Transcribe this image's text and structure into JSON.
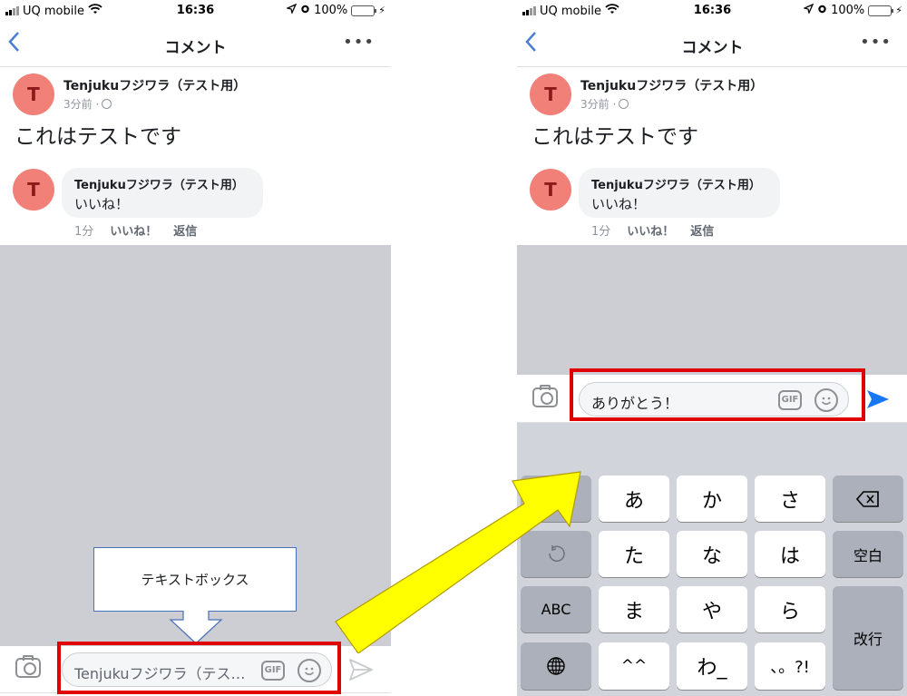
{
  "status_bar": {
    "carrier": "UQ mobile",
    "time": "16:36",
    "battery": "100%",
    "icons": [
      "signal-icon",
      "wifi-icon",
      "location-icon",
      "alarm-icon",
      "battery-icon",
      "charging-icon"
    ]
  },
  "nav": {
    "title": "コメント",
    "back_icon": "chevron-left-icon",
    "more_icon": "ellipsis-icon",
    "more_label": "•••"
  },
  "post": {
    "avatar_initial": "T",
    "author": "Tenjukuフジワラ（テスト用）",
    "time": "3分前 ·",
    "privacy_icon": "globe-icon",
    "body": "これはテストです"
  },
  "comment": {
    "avatar_initial": "T",
    "author": "Tenjukuフジワラ（テスト用）",
    "text": "いいね！",
    "time": "1分",
    "like_label": "いいね！",
    "reply_label": "返信"
  },
  "composer_left": {
    "placeholder": "Tenjukuフジワラ（テス…",
    "gif_label": "GIF",
    "emoji_label": "☺",
    "send_state": "disabled"
  },
  "composer_right": {
    "value": "ありがとう！",
    "gif_label": "GIF",
    "emoji_label": "☺",
    "send_state": "enabled"
  },
  "callout": {
    "label": "テキストボックス"
  },
  "keyboard": {
    "rows": [
      {
        "left": "→",
        "keys": [
          "あ",
          "か",
          "さ"
        ],
        "right": "⌫"
      },
      {
        "left": "↺",
        "keys": [
          "た",
          "な",
          "は"
        ],
        "right": "空白"
      },
      {
        "left": "ABC",
        "keys": [
          "ま",
          "や",
          "ら"
        ],
        "right": "改行"
      },
      {
        "left": "🌐",
        "keys": [
          "^^",
          "わ_",
          "、。?!"
        ]
      }
    ]
  },
  "colors": {
    "accent_blue": "#1877f2",
    "annotation_red": "#e00000",
    "annotation_yellow": "#ffff00",
    "avatar_bg": "#f08078"
  }
}
